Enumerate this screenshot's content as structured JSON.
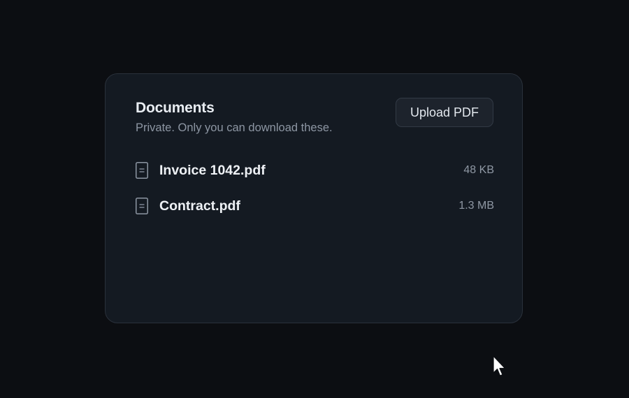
{
  "documents_card": {
    "title": "Documents",
    "subtitle": "Private. Only you can download these.",
    "upload_button_label": "Upload PDF",
    "files": [
      {
        "name": "Invoice 1042.pdf",
        "size": "48 KB",
        "icon": "file-icon"
      },
      {
        "name": "Contract.pdf",
        "size": "1.3 MB",
        "icon": "file-icon"
      }
    ]
  },
  "colors": {
    "background": "#0c0e12",
    "card": "#141a22",
    "card_border": "#2a313b",
    "text_primary": "#eef1f5",
    "text_secondary": "#8d96a3"
  },
  "cursor": {
    "icon": "mouse-pointer-icon"
  }
}
